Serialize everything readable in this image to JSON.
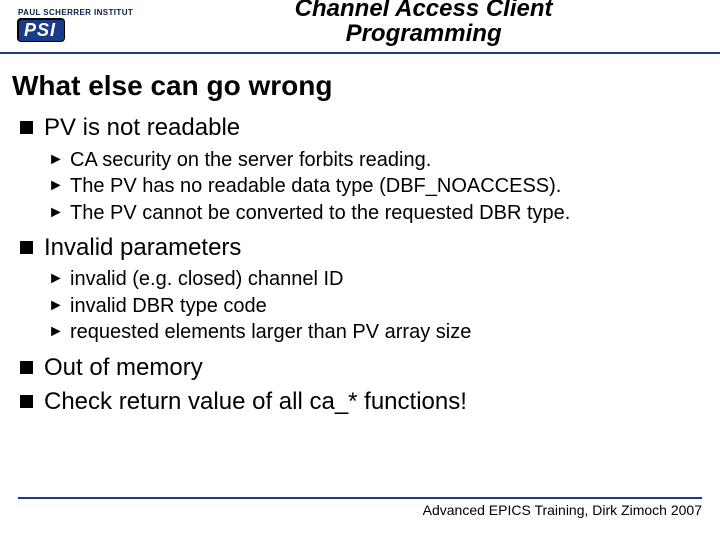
{
  "header": {
    "institute": "PAUL SCHERRER INSTITUT",
    "logo_text": "PSI",
    "title_line1": "Channel Access Client",
    "title_line2": "Programming"
  },
  "slide": {
    "heading": "What else can go wrong",
    "items": [
      {
        "label": "PV is not readable",
        "children": [
          "CA security on the server forbits reading.",
          "The PV has no readable data type (DBF_NOACCESS).",
          "The PV cannot be converted to the requested DBR type."
        ]
      },
      {
        "label": "Invalid parameters",
        "children": [
          "invalid (e.g. closed) channel ID",
          "invalid DBR type code",
          "requested elements larger than PV array size"
        ]
      },
      {
        "label": "Out of memory",
        "children": []
      },
      {
        "label": "Check return value of all ca_* functions!",
        "children": []
      }
    ]
  },
  "footer": {
    "text": "Advanced EPICS Training, Dirk Zimoch 2007"
  }
}
